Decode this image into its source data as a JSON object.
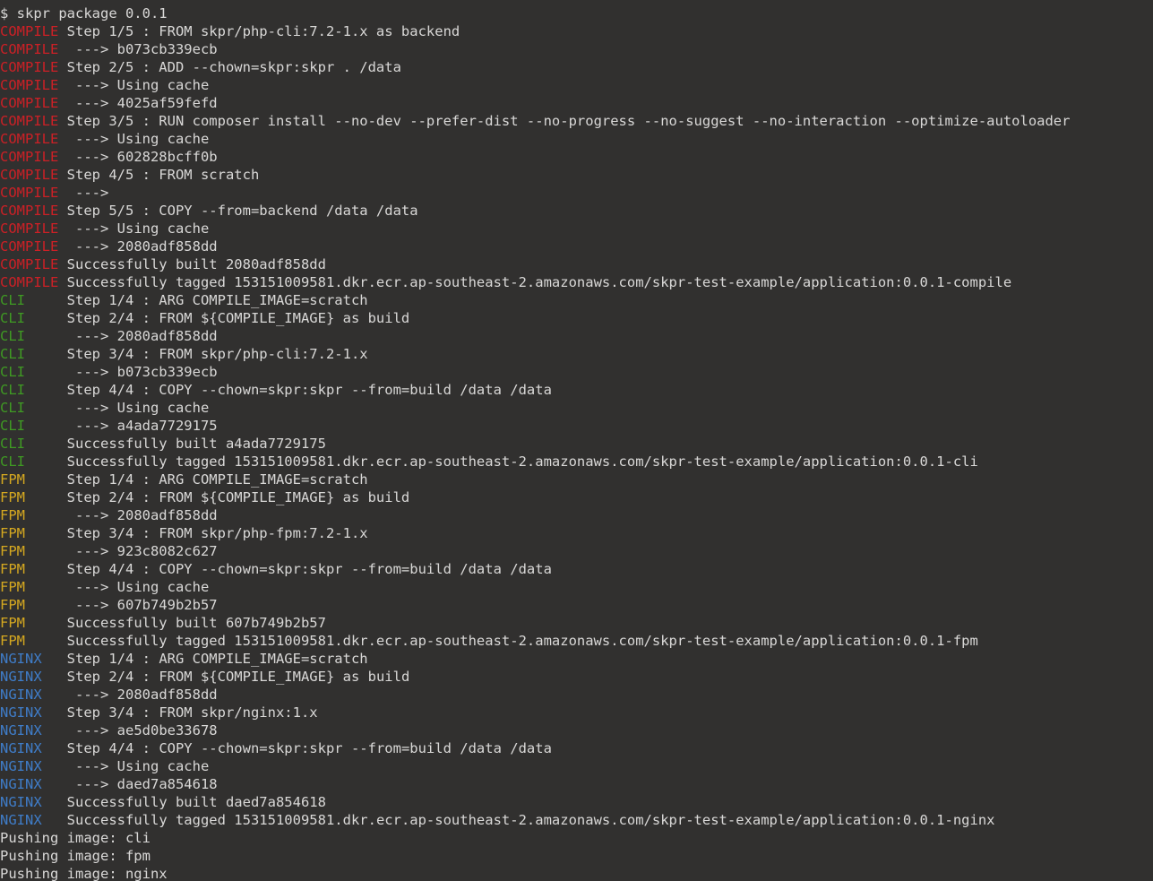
{
  "terminal": {
    "title": "Terminal",
    "background_color": "#31302f",
    "foreground_color": "#d9d8d7",
    "prompt_symbol": "$",
    "command": "skpr package 0.0.1",
    "tag_colors": {
      "COMPILE": "#cc2026",
      "CLI": "#3f9a23",
      "FPM": "#d5a820",
      "NGINX": "#3f7dc9"
    },
    "scrollback_partial_line": {
      "tag": "",
      "text": "  ."
    },
    "lines": [
      {
        "tag": "",
        "tagclass": "none",
        "text": "$ skpr package 0.0.1"
      },
      {
        "tag": "COMPILE",
        "tagclass": "compile",
        "text": " Step 1/5 : FROM skpr/php-cli:7.2-1.x as backend"
      },
      {
        "tag": "COMPILE",
        "tagclass": "compile",
        "text": "  ---> b073cb339ecb"
      },
      {
        "tag": "COMPILE",
        "tagclass": "compile",
        "text": " Step 2/5 : ADD --chown=skpr:skpr . /data"
      },
      {
        "tag": "COMPILE",
        "tagclass": "compile",
        "text": "  ---> Using cache"
      },
      {
        "tag": "COMPILE",
        "tagclass": "compile",
        "text": "  ---> 4025af59fefd"
      },
      {
        "tag": "COMPILE",
        "tagclass": "compile",
        "text": " Step 3/5 : RUN composer install --no-dev --prefer-dist --no-progress --no-suggest --no-interaction --optimize-autoloader"
      },
      {
        "tag": "COMPILE",
        "tagclass": "compile",
        "text": "  ---> Using cache"
      },
      {
        "tag": "COMPILE",
        "tagclass": "compile",
        "text": "  ---> 602828bcff0b"
      },
      {
        "tag": "COMPILE",
        "tagclass": "compile",
        "text": " Step 4/5 : FROM scratch"
      },
      {
        "tag": "COMPILE",
        "tagclass": "compile",
        "text": "  ---> "
      },
      {
        "tag": "COMPILE",
        "tagclass": "compile",
        "text": " Step 5/5 : COPY --from=backend /data /data"
      },
      {
        "tag": "COMPILE",
        "tagclass": "compile",
        "text": "  ---> Using cache"
      },
      {
        "tag": "COMPILE",
        "tagclass": "compile",
        "text": "  ---> 2080adf858dd"
      },
      {
        "tag": "COMPILE",
        "tagclass": "compile",
        "text": " Successfully built 2080adf858dd"
      },
      {
        "tag": "COMPILE",
        "tagclass": "compile",
        "text": " Successfully tagged 153151009581.dkr.ecr.ap-southeast-2.amazonaws.com/skpr-test-example/application:0.0.1-compile"
      },
      {
        "tag": "CLI",
        "tagclass": "cli",
        "text": "     Step 1/4 : ARG COMPILE_IMAGE=scratch"
      },
      {
        "tag": "CLI",
        "tagclass": "cli",
        "text": "     Step 2/4 : FROM ${COMPILE_IMAGE} as build"
      },
      {
        "tag": "CLI",
        "tagclass": "cli",
        "text": "      ---> 2080adf858dd"
      },
      {
        "tag": "CLI",
        "tagclass": "cli",
        "text": "     Step 3/4 : FROM skpr/php-cli:7.2-1.x"
      },
      {
        "tag": "CLI",
        "tagclass": "cli",
        "text": "      ---> b073cb339ecb"
      },
      {
        "tag": "CLI",
        "tagclass": "cli",
        "text": "     Step 4/4 : COPY --chown=skpr:skpr --from=build /data /data"
      },
      {
        "tag": "CLI",
        "tagclass": "cli",
        "text": "      ---> Using cache"
      },
      {
        "tag": "CLI",
        "tagclass": "cli",
        "text": "      ---> a4ada7729175"
      },
      {
        "tag": "CLI",
        "tagclass": "cli",
        "text": "     Successfully built a4ada7729175"
      },
      {
        "tag": "CLI",
        "tagclass": "cli",
        "text": "     Successfully tagged 153151009581.dkr.ecr.ap-southeast-2.amazonaws.com/skpr-test-example/application:0.0.1-cli"
      },
      {
        "tag": "FPM",
        "tagclass": "fpm",
        "text": "     Step 1/4 : ARG COMPILE_IMAGE=scratch"
      },
      {
        "tag": "FPM",
        "tagclass": "fpm",
        "text": "     Step 2/4 : FROM ${COMPILE_IMAGE} as build"
      },
      {
        "tag": "FPM",
        "tagclass": "fpm",
        "text": "      ---> 2080adf858dd"
      },
      {
        "tag": "FPM",
        "tagclass": "fpm",
        "text": "     Step 3/4 : FROM skpr/php-fpm:7.2-1.x"
      },
      {
        "tag": "FPM",
        "tagclass": "fpm",
        "text": "      ---> 923c8082c627"
      },
      {
        "tag": "FPM",
        "tagclass": "fpm",
        "text": "     Step 4/4 : COPY --chown=skpr:skpr --from=build /data /data"
      },
      {
        "tag": "FPM",
        "tagclass": "fpm",
        "text": "      ---> Using cache"
      },
      {
        "tag": "FPM",
        "tagclass": "fpm",
        "text": "      ---> 607b749b2b57"
      },
      {
        "tag": "FPM",
        "tagclass": "fpm",
        "text": "     Successfully built 607b749b2b57"
      },
      {
        "tag": "FPM",
        "tagclass": "fpm",
        "text": "     Successfully tagged 153151009581.dkr.ecr.ap-southeast-2.amazonaws.com/skpr-test-example/application:0.0.1-fpm"
      },
      {
        "tag": "NGINX",
        "tagclass": "nginx",
        "text": "   Step 1/4 : ARG COMPILE_IMAGE=scratch"
      },
      {
        "tag": "NGINX",
        "tagclass": "nginx",
        "text": "   Step 2/4 : FROM ${COMPILE_IMAGE} as build"
      },
      {
        "tag": "NGINX",
        "tagclass": "nginx",
        "text": "    ---> 2080adf858dd"
      },
      {
        "tag": "NGINX",
        "tagclass": "nginx",
        "text": "   Step 3/4 : FROM skpr/nginx:1.x"
      },
      {
        "tag": "NGINX",
        "tagclass": "nginx",
        "text": "    ---> ae5d0be33678"
      },
      {
        "tag": "NGINX",
        "tagclass": "nginx",
        "text": "   Step 4/4 : COPY --chown=skpr:skpr --from=build /data /data"
      },
      {
        "tag": "NGINX",
        "tagclass": "nginx",
        "text": "    ---> Using cache"
      },
      {
        "tag": "NGINX",
        "tagclass": "nginx",
        "text": "    ---> daed7a854618"
      },
      {
        "tag": "NGINX",
        "tagclass": "nginx",
        "text": "   Successfully built daed7a854618"
      },
      {
        "tag": "NGINX",
        "tagclass": "nginx",
        "text": "   Successfully tagged 153151009581.dkr.ecr.ap-southeast-2.amazonaws.com/skpr-test-example/application:0.0.1-nginx"
      },
      {
        "tag": "",
        "tagclass": "none",
        "text": "Pushing image: cli"
      },
      {
        "tag": "",
        "tagclass": "none",
        "text": "Pushing image: fpm"
      },
      {
        "tag": "",
        "tagclass": "none",
        "text": "Pushing image: nginx"
      }
    ]
  }
}
